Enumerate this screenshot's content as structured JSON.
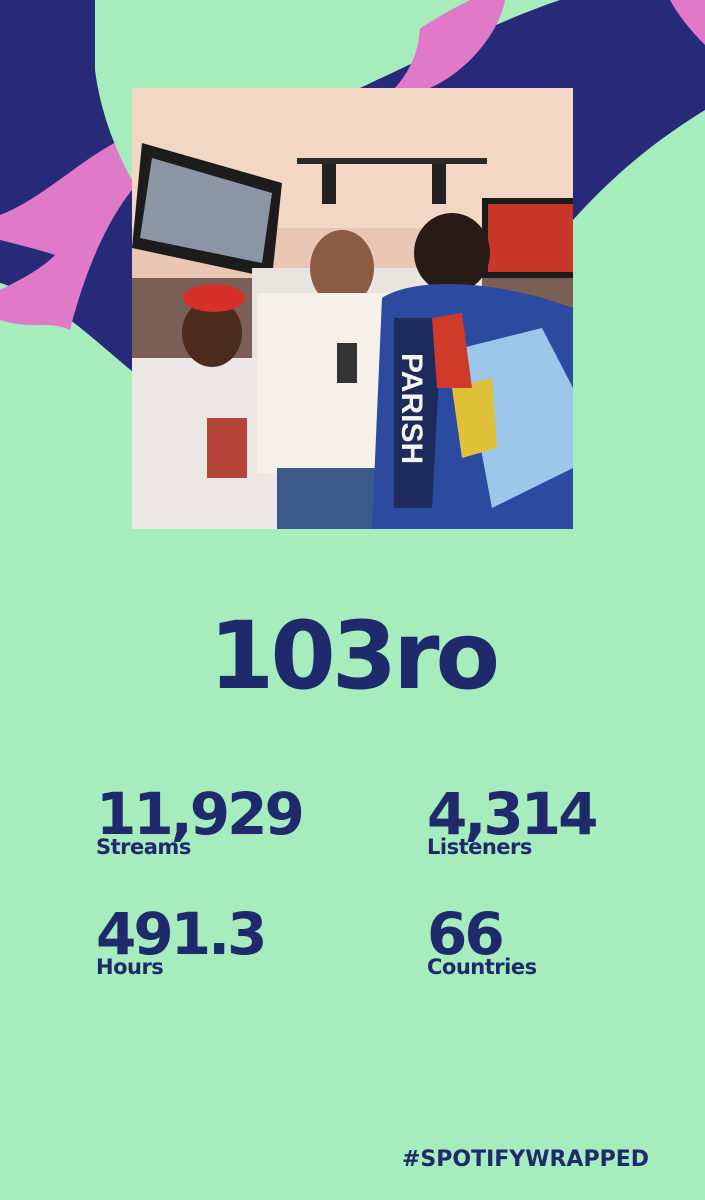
{
  "artist": {
    "name": "103ro",
    "photo_icon": "artist-photo"
  },
  "stats": [
    {
      "value": "11,929",
      "label": "Streams"
    },
    {
      "value": "4,314",
      "label": "Listeners"
    },
    {
      "value": "491.3",
      "label": "Hours"
    },
    {
      "value": "66",
      "label": "Countries"
    }
  ],
  "footer": {
    "hashtag": "#SPOTIFYWRAPPED"
  },
  "colors": {
    "background": "#a6ecbc",
    "text": "#1e2a6c",
    "navy_shape": "#262a78",
    "pink_shape": "#e07ac8"
  }
}
